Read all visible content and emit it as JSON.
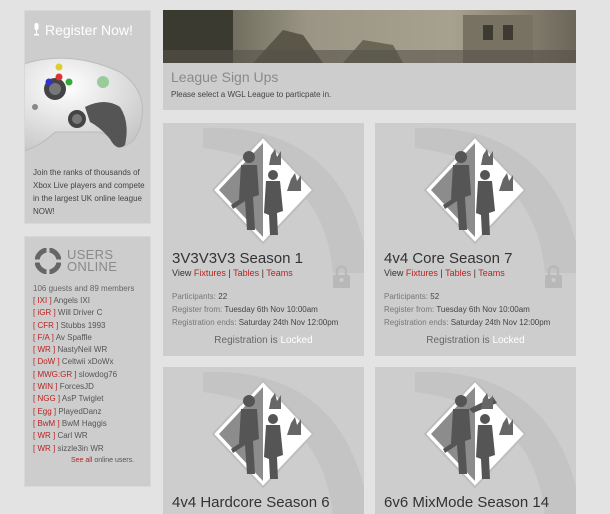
{
  "register": {
    "label": "Register Now!",
    "text": "Join the ranks of thousands of Xbox Live players and compete in the largest UK online league NOW!"
  },
  "users_online": {
    "title_line1": "USERS",
    "title_line2": "ONLINE",
    "count": "106 guests and 89 members",
    "users": [
      {
        "tag": "[ IXI ]",
        "name": "Angels IXI"
      },
      {
        "tag": "[ iGR ]",
        "name": "Will Driver C"
      },
      {
        "tag": "[ CFR ]",
        "name": "Stubbs 1993"
      },
      {
        "tag": "[ F/A ]",
        "name": "Av Spaffle"
      },
      {
        "tag": "[ WR ]",
        "name": "NastyNeil WR"
      },
      {
        "tag": "[ DoW ]",
        "name": "Celtwii xDoWx"
      },
      {
        "tag": "[ MWG:GR ]",
        "name": "slowdog76"
      },
      {
        "tag": "[ WIN ]",
        "name": "ForcesJD"
      },
      {
        "tag": "[ NGG ]",
        "name": "AsP Twiglet"
      },
      {
        "tag": "[ Egg ]",
        "name": "PlayedDanz"
      },
      {
        "tag": "[ BwM ]",
        "name": "BwM Haggis"
      },
      {
        "tag": "[ WR ]",
        "name": "Carl WR"
      },
      {
        "tag": "[ WR ]",
        "name": "sizzle3in WR"
      }
    ],
    "see_all_link": "See all",
    "see_all_suffix": " online users."
  },
  "league": {
    "title": "League Sign Ups",
    "subtitle": "Please select a WGL League to particpate in."
  },
  "cards": [
    {
      "title": "3V3V3V3 Season 1",
      "view": "View",
      "fixtures": "Fixtures",
      "tables": "Tables",
      "teams": "Teams",
      "participants_label": "Participants:",
      "participants": "22",
      "register_from_label": "Register from:",
      "register_from": "Tuesday 6th Nov 10:00am",
      "register_ends_label": "Registration ends:",
      "register_ends": "Saturday 24th Nov 12:00pm",
      "status_prefix": "Registration is",
      "status": "Locked"
    },
    {
      "title": "4v4 Core Season 7",
      "view": "View",
      "fixtures": "Fixtures",
      "tables": "Tables",
      "teams": "Teams",
      "participants_label": "Participants:",
      "participants": "52",
      "register_from_label": "Register from:",
      "register_from": "Tuesday 6th Nov 10:00am",
      "register_ends_label": "Registration ends:",
      "register_ends": "Saturday 24th Nov 12:00pm",
      "status_prefix": "Registration is",
      "status": "Locked"
    },
    {
      "title": "4v4 Hardcore Season 6"
    },
    {
      "title": "6v6 MixMode Season 14"
    }
  ],
  "colors": {
    "accent": "#bb2222",
    "panel": "#cdcdcd",
    "background": "#e3e3e3"
  }
}
